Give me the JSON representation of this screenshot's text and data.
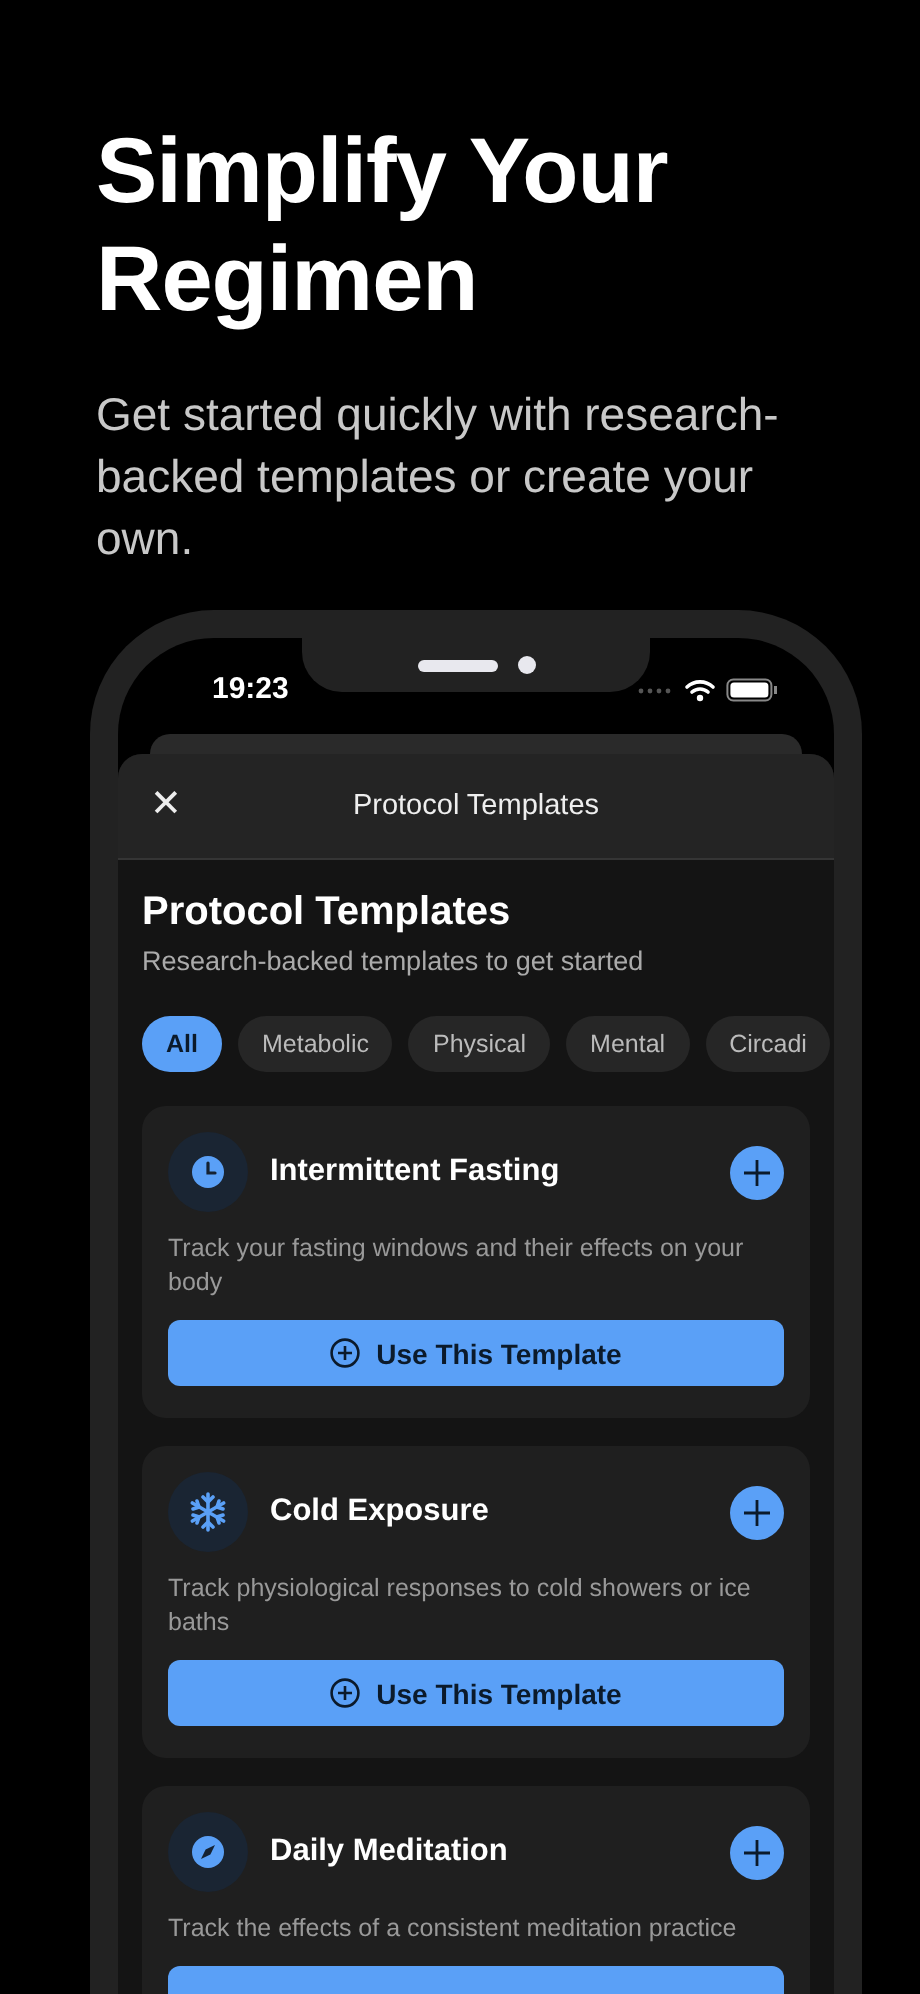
{
  "hero": {
    "title": "Simplify Your Regimen",
    "subtitle": "Get started quickly with research-backed templates or create your own."
  },
  "status_bar": {
    "time": "19:23"
  },
  "sheet": {
    "close_icon": "✕",
    "title": "Protocol Templates"
  },
  "page": {
    "title": "Protocol Templates",
    "subtitle": "Research-backed templates to get started"
  },
  "filters": [
    {
      "label": "All",
      "selected": true
    },
    {
      "label": "Metabolic",
      "selected": false
    },
    {
      "label": "Physical",
      "selected": false
    },
    {
      "label": "Mental",
      "selected": false
    },
    {
      "label": "Circadi",
      "selected": false
    }
  ],
  "templates": [
    {
      "kind": "clock",
      "title": "Intermittent Fasting",
      "description": "Track your fasting windows and their effects on your body",
      "button": "Use This Template"
    },
    {
      "kind": "snowflake",
      "title": "Cold Exposure",
      "description": "Track physiological responses to cold showers or ice baths",
      "button": "Use This Template"
    },
    {
      "kind": "compass",
      "title": "Daily Meditation",
      "description": "Track the effects of a consistent meditation practice"
    }
  ]
}
